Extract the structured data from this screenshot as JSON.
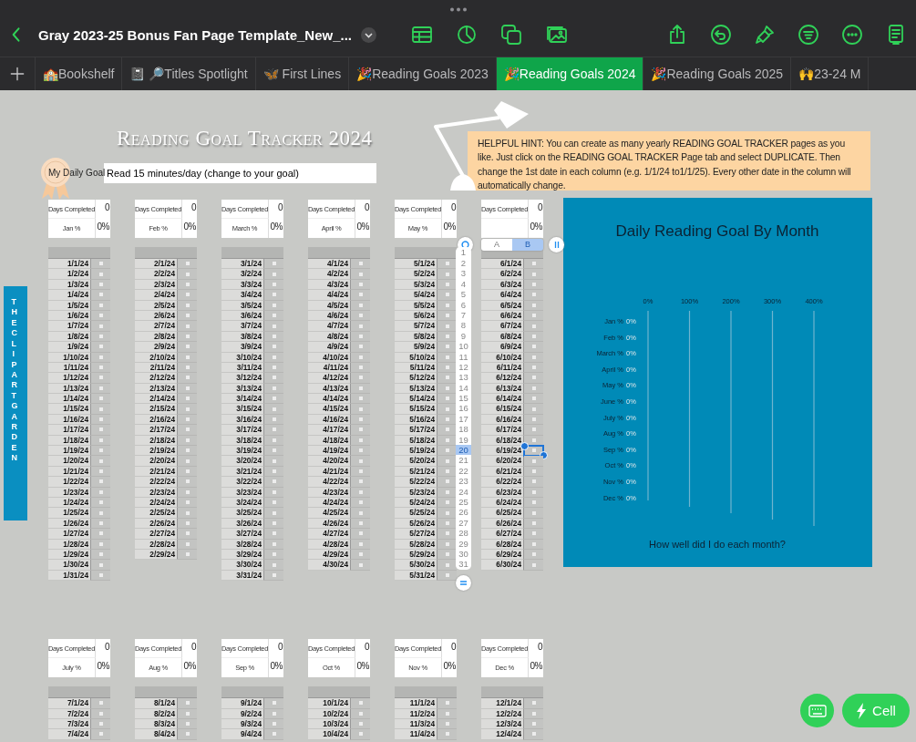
{
  "toolbar": {
    "title": "Gray 2023-25 Bonus Fan Page Template_New_..."
  },
  "tabs": [
    {
      "label": "🏫Bookshelf",
      "selected": false
    },
    {
      "label": "📓 🔎Titles Spotlight",
      "selected": false
    },
    {
      "label": "🦋 First Lines",
      "selected": false
    },
    {
      "label": "🎉Reading Goals 2023",
      "selected": false
    },
    {
      "label": "🎉Reading Goals 2024",
      "selected": true
    },
    {
      "label": "🎉Reading Goals 2025",
      "selected": false
    },
    {
      "label": "🙌23-24 M",
      "selected": false
    }
  ],
  "page": {
    "title": "Reading Goal Tracker 2024",
    "goal_label": "My Daily Goal",
    "goal_value": "Read 15 minutes/day (change to your goal)",
    "hint": "HELPFUL HINT: You can create as many yearly READING GOAL  TRACKER pages as you like. Just click on the READING GOAL  TRACKER Page tab and select DUPLICATE. Then change the 1st date in each column (e.g. 1/1/24 to1/1/25). Every other date in the column will automatically change.",
    "sidebar": "THE CLIPART GARDEN"
  },
  "months_top": [
    {
      "completed_label": "Days Completed",
      "completed": "0",
      "label": "Jan %",
      "percent": "0%",
      "days": [
        {
          "date": "1/1/24",
          "checked": false
        },
        {
          "date": "1/2/24",
          "checked": false
        },
        {
          "date": "1/3/24",
          "checked": false
        },
        {
          "date": "1/4/24",
          "checked": false
        },
        {
          "date": "1/5/24",
          "checked": false
        },
        {
          "date": "1/6/24",
          "checked": false
        },
        {
          "date": "1/7/24",
          "checked": false
        },
        {
          "date": "1/8/24",
          "checked": false
        },
        {
          "date": "1/9/24",
          "checked": false
        },
        {
          "date": "1/10/24",
          "checked": false
        },
        {
          "date": "1/11/24",
          "checked": false
        },
        {
          "date": "1/12/24",
          "checked": false
        },
        {
          "date": "1/13/24",
          "checked": false
        },
        {
          "date": "1/14/24",
          "checked": false
        },
        {
          "date": "1/15/24",
          "checked": false
        },
        {
          "date": "1/16/24",
          "checked": false
        },
        {
          "date": "1/17/24",
          "checked": false
        },
        {
          "date": "1/18/24",
          "checked": false
        },
        {
          "date": "1/19/24",
          "checked": false
        },
        {
          "date": "1/20/24",
          "checked": false
        },
        {
          "date": "1/21/24",
          "checked": false
        },
        {
          "date": "1/22/24",
          "checked": false
        },
        {
          "date": "1/23/24",
          "checked": false
        },
        {
          "date": "1/24/24",
          "checked": false
        },
        {
          "date": "1/25/24",
          "checked": false
        },
        {
          "date": "1/26/24",
          "checked": false
        },
        {
          "date": "1/27/24",
          "checked": false
        },
        {
          "date": "1/28/24",
          "checked": false
        },
        {
          "date": "1/29/24",
          "checked": false
        },
        {
          "date": "1/30/24",
          "checked": false
        },
        {
          "date": "1/31/24",
          "checked": false
        }
      ]
    },
    {
      "completed_label": "Days Completed",
      "completed": "0",
      "label": "Feb %",
      "percent": "0%",
      "days": [
        {
          "date": "2/1/24",
          "checked": false
        },
        {
          "date": "2/2/24",
          "checked": false
        },
        {
          "date": "2/3/24",
          "checked": false
        },
        {
          "date": "2/4/24",
          "checked": false
        },
        {
          "date": "2/5/24",
          "checked": false
        },
        {
          "date": "2/6/24",
          "checked": false
        },
        {
          "date": "2/7/24",
          "checked": false
        },
        {
          "date": "2/8/24",
          "checked": false
        },
        {
          "date": "2/9/24",
          "checked": false
        },
        {
          "date": "2/10/24",
          "checked": false
        },
        {
          "date": "2/11/24",
          "checked": false
        },
        {
          "date": "2/12/24",
          "checked": false
        },
        {
          "date": "2/13/24",
          "checked": false
        },
        {
          "date": "2/14/24",
          "checked": false
        },
        {
          "date": "2/15/24",
          "checked": false
        },
        {
          "date": "2/16/24",
          "checked": false
        },
        {
          "date": "2/17/24",
          "checked": false
        },
        {
          "date": "2/18/24",
          "checked": false
        },
        {
          "date": "2/19/24",
          "checked": false
        },
        {
          "date": "2/20/24",
          "checked": false
        },
        {
          "date": "2/21/24",
          "checked": false
        },
        {
          "date": "2/22/24",
          "checked": false
        },
        {
          "date": "2/23/24",
          "checked": false
        },
        {
          "date": "2/24/24",
          "checked": false
        },
        {
          "date": "2/25/24",
          "checked": false
        },
        {
          "date": "2/26/24",
          "checked": false
        },
        {
          "date": "2/27/24",
          "checked": false
        },
        {
          "date": "2/28/24",
          "checked": false
        },
        {
          "date": "2/29/24",
          "checked": false
        }
      ]
    },
    {
      "completed_label": "Days Completed",
      "completed": "0",
      "label": "March %",
      "percent": "0%",
      "days": [
        {
          "date": "3/1/24",
          "checked": false
        },
        {
          "date": "3/2/24",
          "checked": false
        },
        {
          "date": "3/3/24",
          "checked": false
        },
        {
          "date": "3/4/24",
          "checked": false
        },
        {
          "date": "3/5/24",
          "checked": false
        },
        {
          "date": "3/6/24",
          "checked": false
        },
        {
          "date": "3/7/24",
          "checked": false
        },
        {
          "date": "3/8/24",
          "checked": false
        },
        {
          "date": "3/9/24",
          "checked": false
        },
        {
          "date": "3/10/24",
          "checked": false
        },
        {
          "date": "3/11/24",
          "checked": false
        },
        {
          "date": "3/12/24",
          "checked": false
        },
        {
          "date": "3/13/24",
          "checked": false
        },
        {
          "date": "3/14/24",
          "checked": false
        },
        {
          "date": "3/15/24",
          "checked": false
        },
        {
          "date": "3/16/24",
          "checked": false
        },
        {
          "date": "3/17/24",
          "checked": false
        },
        {
          "date": "3/18/24",
          "checked": false
        },
        {
          "date": "3/19/24",
          "checked": false
        },
        {
          "date": "3/20/24",
          "checked": false
        },
        {
          "date": "3/21/24",
          "checked": false
        },
        {
          "date": "3/22/24",
          "checked": false
        },
        {
          "date": "3/23/24",
          "checked": false
        },
        {
          "date": "3/24/24",
          "checked": false
        },
        {
          "date": "3/25/24",
          "checked": false
        },
        {
          "date": "3/26/24",
          "checked": false
        },
        {
          "date": "3/27/24",
          "checked": false
        },
        {
          "date": "3/28/24",
          "checked": false
        },
        {
          "date": "3/29/24",
          "checked": false
        },
        {
          "date": "3/30/24",
          "checked": false
        },
        {
          "date": "3/31/24",
          "checked": false
        }
      ]
    },
    {
      "completed_label": "Days Completed",
      "completed": "0",
      "label": "April %",
      "percent": "0%",
      "days": [
        {
          "date": "4/1/24",
          "checked": false
        },
        {
          "date": "4/2/24",
          "checked": false
        },
        {
          "date": "4/3/24",
          "checked": false
        },
        {
          "date": "4/4/24",
          "checked": false
        },
        {
          "date": "4/5/24",
          "checked": false
        },
        {
          "date": "4/6/24",
          "checked": false
        },
        {
          "date": "4/7/24",
          "checked": false
        },
        {
          "date": "4/8/24",
          "checked": false
        },
        {
          "date": "4/9/24",
          "checked": false
        },
        {
          "date": "4/10/24",
          "checked": false
        },
        {
          "date": "4/11/24",
          "checked": false
        },
        {
          "date": "4/12/24",
          "checked": false
        },
        {
          "date": "4/13/24",
          "checked": false
        },
        {
          "date": "4/14/24",
          "checked": false
        },
        {
          "date": "4/15/24",
          "checked": false
        },
        {
          "date": "4/16/24",
          "checked": false
        },
        {
          "date": "4/17/24",
          "checked": false
        },
        {
          "date": "4/18/24",
          "checked": false
        },
        {
          "date": "4/19/24",
          "checked": false
        },
        {
          "date": "4/20/24",
          "checked": false
        },
        {
          "date": "4/21/24",
          "checked": false
        },
        {
          "date": "4/22/24",
          "checked": false
        },
        {
          "date": "4/23/24",
          "checked": false
        },
        {
          "date": "4/24/24",
          "checked": false
        },
        {
          "date": "4/25/24",
          "checked": false
        },
        {
          "date": "4/26/24",
          "checked": false
        },
        {
          "date": "4/27/24",
          "checked": false
        },
        {
          "date": "4/28/24",
          "checked": false
        },
        {
          "date": "4/29/24",
          "checked": false
        },
        {
          "date": "4/30/24",
          "checked": false
        }
      ]
    },
    {
      "completed_label": "Days Completed",
      "completed": "0",
      "label": "May %",
      "percent": "0%",
      "days": [
        {
          "date": "5/1/24",
          "checked": false
        },
        {
          "date": "5/2/24",
          "checked": false
        },
        {
          "date": "5/3/24",
          "checked": false
        },
        {
          "date": "5/4/24",
          "checked": false
        },
        {
          "date": "5/5/24",
          "checked": false
        },
        {
          "date": "5/6/24",
          "checked": false
        },
        {
          "date": "5/7/24",
          "checked": false
        },
        {
          "date": "5/8/24",
          "checked": false
        },
        {
          "date": "5/9/24",
          "checked": false
        },
        {
          "date": "5/10/24",
          "checked": false
        },
        {
          "date": "5/11/24",
          "checked": false
        },
        {
          "date": "5/12/24",
          "checked": false
        },
        {
          "date": "5/13/24",
          "checked": false
        },
        {
          "date": "5/14/24",
          "checked": false
        },
        {
          "date": "5/15/24",
          "checked": false
        },
        {
          "date": "5/16/24",
          "checked": false
        },
        {
          "date": "5/17/24",
          "checked": false
        },
        {
          "date": "5/18/24",
          "checked": false
        },
        {
          "date": "5/19/24",
          "checked": false
        },
        {
          "date": "5/20/24",
          "checked": false
        },
        {
          "date": "5/21/24",
          "checked": false
        },
        {
          "date": "5/22/24",
          "checked": false
        },
        {
          "date": "5/23/24",
          "checked": false
        },
        {
          "date": "5/24/24",
          "checked": false
        },
        {
          "date": "5/25/24",
          "checked": false
        },
        {
          "date": "5/26/24",
          "checked": false
        },
        {
          "date": "5/27/24",
          "checked": false
        },
        {
          "date": "5/28/24",
          "checked": false
        },
        {
          "date": "5/29/24",
          "checked": false
        },
        {
          "date": "5/30/24",
          "checked": false
        },
        {
          "date": "5/31/24",
          "checked": false
        }
      ]
    },
    {
      "completed_label": "Days Completed",
      "completed": "0",
      "percent": "0%",
      "days": [
        {
          "date": "6/1/24",
          "checked": false
        },
        {
          "date": "6/2/24",
          "checked": false
        },
        {
          "date": "6/3/24",
          "checked": false
        },
        {
          "date": "6/4/24",
          "checked": false
        },
        {
          "date": "6/5/24",
          "checked": false
        },
        {
          "date": "6/6/24",
          "checked": false
        },
        {
          "date": "6/7/24",
          "checked": false
        },
        {
          "date": "6/8/24",
          "checked": false
        },
        {
          "date": "6/9/24",
          "checked": false
        },
        {
          "date": "6/10/24",
          "checked": false
        },
        {
          "date": "6/11/24",
          "checked": false
        },
        {
          "date": "6/12/24",
          "checked": false
        },
        {
          "date": "6/13/24",
          "checked": false
        },
        {
          "date": "6/14/24",
          "checked": false
        },
        {
          "date": "6/15/24",
          "checked": false
        },
        {
          "date": "6/16/24",
          "checked": false
        },
        {
          "date": "6/17/24",
          "checked": false
        },
        {
          "date": "6/18/24",
          "checked": false
        },
        {
          "date": "6/19/24",
          "checked": false
        },
        {
          "date": "6/20/24",
          "checked": false
        },
        {
          "date": "6/21/24",
          "checked": false
        },
        {
          "date": "6/22/24",
          "checked": false
        },
        {
          "date": "6/23/24",
          "checked": false
        },
        {
          "date": "6/24/24",
          "checked": false
        },
        {
          "date": "6/25/24",
          "checked": false
        },
        {
          "date": "6/26/24",
          "checked": false
        },
        {
          "date": "6/27/24",
          "checked": false
        },
        {
          "date": "6/28/24",
          "checked": false
        },
        {
          "date": "6/29/24",
          "checked": false
        },
        {
          "date": "6/30/24",
          "checked": false
        }
      ],
      "editor": {
        "columns": [
          {
            "label": "A",
            "selected": false
          },
          {
            "label": "B",
            "selected": true
          }
        ],
        "rows": [
          {
            "label": "1",
            "selected": false
          },
          {
            "label": "2",
            "selected": false
          },
          {
            "label": "3",
            "selected": false
          },
          {
            "label": "4",
            "selected": false
          },
          {
            "label": "5",
            "selected": false
          },
          {
            "label": "6",
            "selected": false
          },
          {
            "label": "7",
            "selected": false
          },
          {
            "label": "8",
            "selected": false
          },
          {
            "label": "9",
            "selected": false
          },
          {
            "label": "10",
            "selected": false
          },
          {
            "label": "11",
            "selected": false
          },
          {
            "label": "12",
            "selected": false
          },
          {
            "label": "13",
            "selected": false
          },
          {
            "label": "14",
            "selected": false
          },
          {
            "label": "15",
            "selected": false
          },
          {
            "label": "16",
            "selected": false
          },
          {
            "label": "17",
            "selected": false
          },
          {
            "label": "18",
            "selected": false
          },
          {
            "label": "19",
            "selected": false
          },
          {
            "label": "20",
            "selected": true
          },
          {
            "label": "21",
            "selected": false
          },
          {
            "label": "22",
            "selected": false
          },
          {
            "label": "23",
            "selected": false
          },
          {
            "label": "24",
            "selected": false
          },
          {
            "label": "25",
            "selected": false
          },
          {
            "label": "26",
            "selected": false
          },
          {
            "label": "27",
            "selected": false
          },
          {
            "label": "28",
            "selected": false
          },
          {
            "label": "29",
            "selected": false
          },
          {
            "label": "30",
            "selected": false
          },
          {
            "label": "31",
            "selected": false
          }
        ]
      }
    }
  ],
  "chart": {
    "chart_data": {
      "type": "bar",
      "orientation": "horizontal",
      "title": "Daily Reading Goal By Month",
      "xlabel": "How well did I do each month?",
      "categories": [
        "Jan %",
        "Feb %",
        "March %",
        "April %",
        "May %",
        "June %",
        "July %",
        "Aug %",
        "Sep %",
        "Oct %",
        "Nov %",
        "Dec %"
      ],
      "values": [
        0,
        0,
        0,
        0,
        0,
        0,
        0,
        0,
        0,
        0,
        0,
        0
      ],
      "value_labels": [
        "0%",
        "0%",
        "0%",
        "0%",
        "0%",
        "0%",
        "0%",
        "0%",
        "0%",
        "0%",
        "0%",
        "0%"
      ],
      "xlim": [
        0,
        400
      ],
      "grid": true,
      "xticks": [
        {
          "value": 0,
          "label": "0%"
        },
        {
          "value": 100,
          "label": "100%"
        },
        {
          "value": 200,
          "label": "200%"
        },
        {
          "value": 300,
          "label": "300%"
        },
        {
          "value": 400,
          "label": "400%"
        }
      ]
    }
  },
  "months_bottom": [
    {
      "completed_label": "Days Completed",
      "completed": "0",
      "label": "July %",
      "percent": "0%",
      "days": [
        {
          "date": "7/1/24",
          "checked": false
        },
        {
          "date": "7/2/24",
          "checked": false
        },
        {
          "date": "7/3/24",
          "checked": false
        },
        {
          "date": "7/4/24",
          "checked": false
        }
      ]
    },
    {
      "completed_label": "Days Completed",
      "completed": "0",
      "label": "Aug %",
      "percent": "0%",
      "days": [
        {
          "date": "8/1/24",
          "checked": false
        },
        {
          "date": "8/2/24",
          "checked": false
        },
        {
          "date": "8/3/24",
          "checked": false
        },
        {
          "date": "8/4/24",
          "checked": false
        }
      ]
    },
    {
      "completed_label": "Days Completed",
      "completed": "0",
      "label": "Sep %",
      "percent": "0%",
      "days": [
        {
          "date": "9/1/24",
          "checked": false
        },
        {
          "date": "9/2/24",
          "checked": false
        },
        {
          "date": "9/3/24",
          "checked": false
        },
        {
          "date": "9/4/24",
          "checked": false
        }
      ]
    },
    {
      "completed_label": "Days Completed",
      "completed": "0",
      "label": "Oct %",
      "percent": "0%",
      "days": [
        {
          "date": "10/1/24",
          "checked": false
        },
        {
          "date": "10/2/24",
          "checked": false
        },
        {
          "date": "10/3/24",
          "checked": false
        },
        {
          "date": "10/4/24",
          "checked": false
        }
      ]
    },
    {
      "completed_label": "Days Completed",
      "completed": "0",
      "label": "Nov %",
      "percent": "0%",
      "days": [
        {
          "date": "11/1/24",
          "checked": false
        },
        {
          "date": "11/2/24",
          "checked": false
        },
        {
          "date": "11/3/24",
          "checked": false
        },
        {
          "date": "11/4/24",
          "checked": false
        }
      ]
    },
    {
      "completed_label": "Days Completed",
      "completed": "0",
      "label": "Dec %",
      "percent": "0%",
      "days": [
        {
          "date": "12/1/24",
          "checked": false
        },
        {
          "date": "12/2/24",
          "checked": false
        },
        {
          "date": "12/3/24",
          "checked": false
        },
        {
          "date": "12/4/24",
          "checked": false
        }
      ]
    }
  ],
  "action_button": {
    "label": "Cell"
  }
}
